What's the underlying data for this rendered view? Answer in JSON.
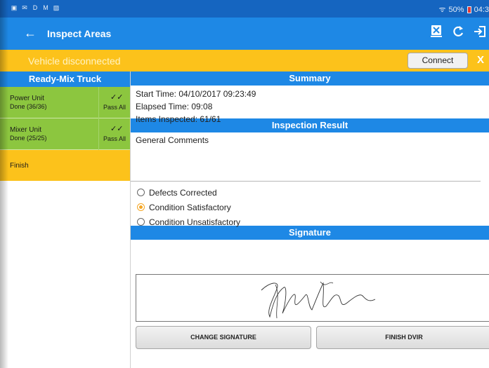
{
  "status_bar": {
    "left_icons": [
      "gallery-icon",
      "mail-icon",
      "d-icon",
      "gmail-icon",
      "photo-icon"
    ],
    "left_glyphs": [
      "▣",
      "✉",
      "D",
      "M",
      "▨"
    ],
    "wifi": "ᯤ",
    "battery_text": "50%",
    "time": "04:3"
  },
  "app_bar": {
    "back_glyph": "←",
    "title": "Inspect Areas",
    "actions": [
      {
        "name": "report-icon",
        "glyph": "⊠"
      },
      {
        "name": "refresh-icon",
        "glyph": "C"
      },
      {
        "name": "logout-icon",
        "glyph": "⇲"
      }
    ]
  },
  "banner": {
    "message": "Vehicle disconnected",
    "connect_label": "Connect",
    "close_label": "X"
  },
  "sidebar": {
    "title": "Ready-Mix Truck",
    "units": [
      {
        "name": "Power Unit",
        "status": "Done (36/36)",
        "check": "✓✓",
        "pass_label": "Pass All"
      },
      {
        "name": "Mixer Unit",
        "status": "Done (25/25)",
        "check": "✓✓",
        "pass_label": "Pass All"
      }
    ],
    "finish_label": "Finish"
  },
  "summary": {
    "title": "Summary",
    "start_time": "Start Time: 04/10/2017 09:23:49",
    "elapsed_time": "Elapsed Time: 09:08",
    "items_inspected": "Items Inspected: 61/61"
  },
  "inspection_result": {
    "title": "Inspection Result",
    "comments_label": "General Comments",
    "options": [
      {
        "label": "Defects Corrected",
        "selected": false
      },
      {
        "label": "Condition Satisfactory",
        "selected": true
      },
      {
        "label": "Condition Unsatisfactory",
        "selected": false
      }
    ]
  },
  "signature": {
    "title": "Signature",
    "change_label": "CHANGE SIGNATURE",
    "finish_label": "FINISH DVIR"
  },
  "colors": {
    "status_bar": "#1565c0",
    "app_bar": "#1e88e5",
    "banner": "#fcc21b",
    "unit_done": "#8cc63f",
    "finish": "#fcc21b",
    "radio_selected": "#f5a623"
  }
}
